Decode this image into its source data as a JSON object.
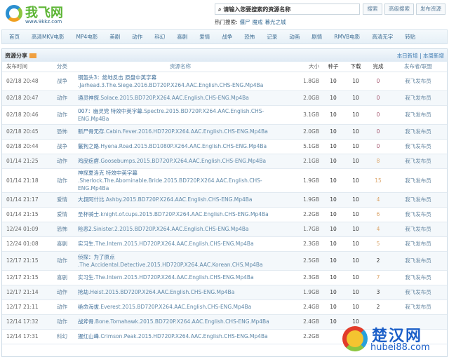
{
  "site": {
    "name": "我飞网",
    "url": "www.9kkz.com"
  },
  "search": {
    "placeholder": "请输入您要搜索的资源名称",
    "buttons": [
      "搜索",
      "高级搜索",
      "发布资源"
    ],
    "hot_label": "热门搜索:",
    "hot": [
      "僵尸",
      "魔戒",
      "暮光之城"
    ]
  },
  "nav": [
    "首页",
    "高清MKV电影",
    "MP4电影",
    "美剧",
    "动作",
    "科幻",
    "喜剧",
    "爱情",
    "战争",
    "恐怖",
    "记录",
    "动画",
    "剧情",
    "RMVB电影",
    "高清无字",
    "转贴"
  ],
  "section": {
    "title": "资源分享",
    "links": [
      "本日新增",
      "本周新增"
    ],
    "sep": "|"
  },
  "columns": [
    "发布时间",
    "分类",
    "资源名称",
    "大小",
    "种子",
    "下载",
    "完成",
    "发布者/联盟"
  ],
  "colors": {
    "done_zero": "#a0506a",
    "done_mid": "#dba56a",
    "done_dark": "#333333"
  },
  "rows": [
    {
      "time": "02/18 20:48",
      "cat": "战争",
      "cn": "钢盔头3：绝地反击 原盘中英字幕",
      "en": ".Jarhead.3.The.Siege.2016.BD720P.X264.AAC.English.CHS-ENG.Mp4Ba",
      "size": "1.8GB",
      "seed": "10",
      "dl": "10",
      "done": "0",
      "pub": "我飞发布员"
    },
    {
      "time": "02/18 20:47",
      "cat": "动作",
      "cn": "通灵神探",
      "en": ".Solace.2015.BD720P.X264.AAC.English.CHS-ENG.Mp4Ba",
      "size": "2.0GB",
      "seed": "10",
      "dl": "10",
      "done": "0",
      "pub": "我飞发布员"
    },
    {
      "time": "02/18 20:46",
      "cat": "动作",
      "cn": "007：幽灵党 特效中英字幕",
      "en": ".Spectre.2015.BD720P.X264.AAC.English.CHS-ENG.Mp4Ba",
      "size": "3.1GB",
      "seed": "10",
      "dl": "10",
      "done": "0",
      "pub": "我飞发布员"
    },
    {
      "time": "02/18 20:45",
      "cat": "恐怖",
      "cn": "新尸骨无存",
      "en": ".Cabin.Fever.2016.HD720P.X264.AAC.English.CHS-ENG.Mp4Ba",
      "size": "2.0GB",
      "seed": "10",
      "dl": "10",
      "done": "0",
      "pub": "我飞发布员"
    },
    {
      "time": "02/18 20:44",
      "cat": "战争",
      "cn": "鬣狗之路",
      "en": ".Hyena.Road.2015.BD1080P.X264.AAC.English.CHS-ENG.Mp4Ba",
      "size": "5.1GB",
      "seed": "10",
      "dl": "10",
      "done": "0",
      "pub": "我飞发布员"
    },
    {
      "time": "01/14 21:25",
      "cat": "动作",
      "cn": "鸡皮疙瘩",
      "en": ".Goosebumps.2015.BD720P.X264.AAC.English.CHS-ENG.Mp4Ba",
      "size": "2.1GB",
      "seed": "10",
      "dl": "10",
      "done": "8",
      "pub": "我飞发布员"
    },
    {
      "time": "01/14 21:18",
      "cat": "动作",
      "cn": "神探夏洛克 特效中英字幕",
      "en": ".Sherlock.The.Abominable.Bride.2015.BD720P.X264.AAC.English.CHS-ENG.Mp4Ba",
      "size": "1.9GB",
      "seed": "10",
      "dl": "10",
      "done": "15",
      "pub": "我飞发布员"
    },
    {
      "time": "01/14 21:17",
      "cat": "爱情",
      "cn": "大叔阿什比",
      "en": ".Ashby.2015.BD720P.X264.AAC.English.CHS-ENG.Mp4Ba",
      "size": "1.9GB",
      "seed": "10",
      "dl": "10",
      "done": "4",
      "pub": "我飞发布员"
    },
    {
      "time": "01/14 21:15",
      "cat": "爱情",
      "cn": "圣杯骑士",
      "en": ".knight.of.cups.2015.BD720P.X264.AAC.English.CHS-ENG.Mp4Ba",
      "size": "2.2GB",
      "seed": "10",
      "dl": "10",
      "done": "6",
      "pub": "我飞发布员"
    },
    {
      "time": "12/24 01:09",
      "cat": "恐怖",
      "cn": "险恶2",
      "en": ".Sinister.2.2015.BD720P.X264.AAC.English.CHS-ENG.Mp4Ba",
      "size": "1.7GB",
      "seed": "10",
      "dl": "10",
      "done": "4",
      "pub": "我飞发布员"
    },
    {
      "time": "12/24 01:08",
      "cat": "喜剧",
      "cn": "实习生",
      "en": ".The.Intern.2015.HD720P.X264.AAC.English.CHS-ENG.Mp4Ba",
      "size": "2.3GB",
      "seed": "10",
      "dl": "10",
      "done": "5",
      "pub": "我飞发布员"
    },
    {
      "time": "12/17 21:15",
      "cat": "动作",
      "cn": "侦探：为了原点",
      "en": ".The.Accidental.Detective.2015.HD720P.X264.AAC.Korean.CHS.Mp4Ba",
      "size": "2.5GB",
      "seed": "10",
      "dl": "10",
      "done": "2",
      "pub": "我飞发布员"
    },
    {
      "time": "12/17 21:15",
      "cat": "喜剧",
      "cn": "实习生",
      "en": ".The.Intern.2015.HD720P.X264.AAC.English.CHS-ENG.Mp4Ba",
      "size": "2.3GB",
      "seed": "10",
      "dl": "10",
      "done": "7",
      "pub": "我飞发布员"
    },
    {
      "time": "12/17 21:14",
      "cat": "动作",
      "cn": "抢劫",
      "en": ".Heist.2015.BD720P.X264.AAC.English.CHS-ENG.Mp4Ba",
      "size": "1.9GB",
      "seed": "10",
      "dl": "10",
      "done": "3",
      "pub": "我飞发布员"
    },
    {
      "time": "12/17 21:11",
      "cat": "动作",
      "cn": "绝命海拔",
      "en": ".Everest.2015.BD720P.X264.AAC.English.CHS-ENG.Mp4Ba",
      "size": "2.4GB",
      "seed": "10",
      "dl": "10",
      "done": "2",
      "pub": "我飞发布员"
    },
    {
      "time": "12/14 17:32",
      "cat": "动作",
      "cn": "战斧骨",
      "en": ".Bone.Tomahawk.2015.BD720P.X264.AAC.English.CHS-ENG.Mp4Ba",
      "size": "2.4GB",
      "seed": "10",
      "dl": "10",
      "done": "",
      "pub": ""
    },
    {
      "time": "12/14 17:31",
      "cat": "科幻",
      "cn": "猩红山峰",
      "en": ".Crimson.Peak.2015.HD720P.X264.AAC.English.CHS-ENG.Mp4Ba",
      "size": "2.2GB",
      "seed": "",
      "dl": "",
      "done": "",
      "pub": ""
    }
  ],
  "two_line": [
    0,
    2,
    6,
    11
  ],
  "watermark": {
    "text": "楚汉网",
    "url": "hubei88.com"
  }
}
